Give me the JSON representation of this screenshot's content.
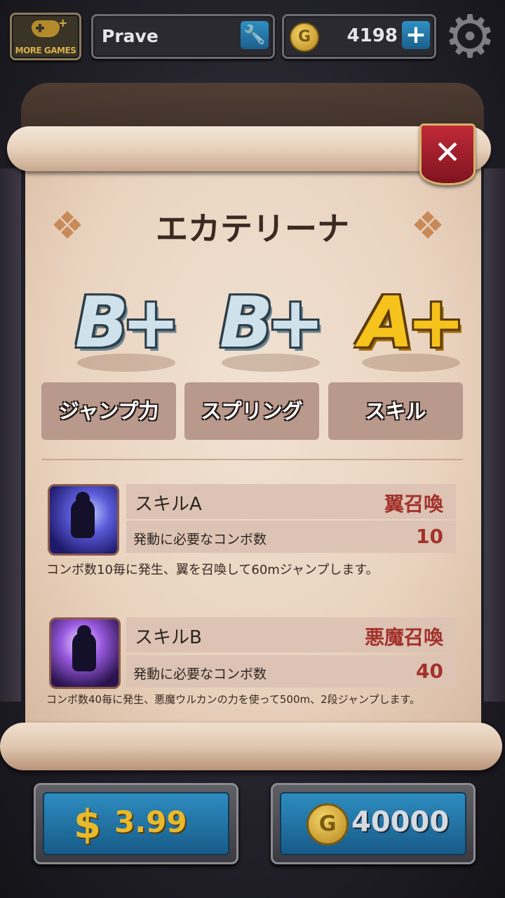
{
  "topbar": {
    "more_games_label": "MORE GAMES",
    "player_name": "Prave",
    "coin_amount": "4198"
  },
  "icons": {
    "more_games": "gamepad-plus-icon",
    "edit_name": "wrench-icon",
    "coin": "coin-icon",
    "add_coins": "plus-icon",
    "settings": "gear-icon",
    "close": "close-icon"
  },
  "character": {
    "name": "エカテリーナ"
  },
  "grades": [
    {
      "grade": "B+",
      "label": "ジャンプ力",
      "tier": "silver"
    },
    {
      "grade": "B+",
      "label": "スプリング",
      "tier": "silver"
    },
    {
      "grade": "A+",
      "label": "スキル",
      "tier": "gold"
    }
  ],
  "skills": [
    {
      "name": "スキルA",
      "skill_name": "翼召喚",
      "combo_label": "発動に必要なコンボ数",
      "combo_value": "10",
      "description": "コンボ数10毎に発生、翼を召喚して60mジャンプします。"
    },
    {
      "name": "スキルB",
      "skill_name": "悪魔召喚",
      "combo_label": "発動に必要なコンボ数",
      "combo_value": "40",
      "description": "コンボ数40毎に発生、悪魔ウルカンの力を使って500m、2段ジャンプします。"
    }
  ],
  "purchase": {
    "usd_symbol": "$",
    "usd_price": "3.99",
    "coin_price": "40000"
  },
  "colors": {
    "accent_blue": "#2e8cc0",
    "gold": "#e9b92c",
    "skill_red": "#a3322b",
    "parchment": "#ecd7c4"
  }
}
